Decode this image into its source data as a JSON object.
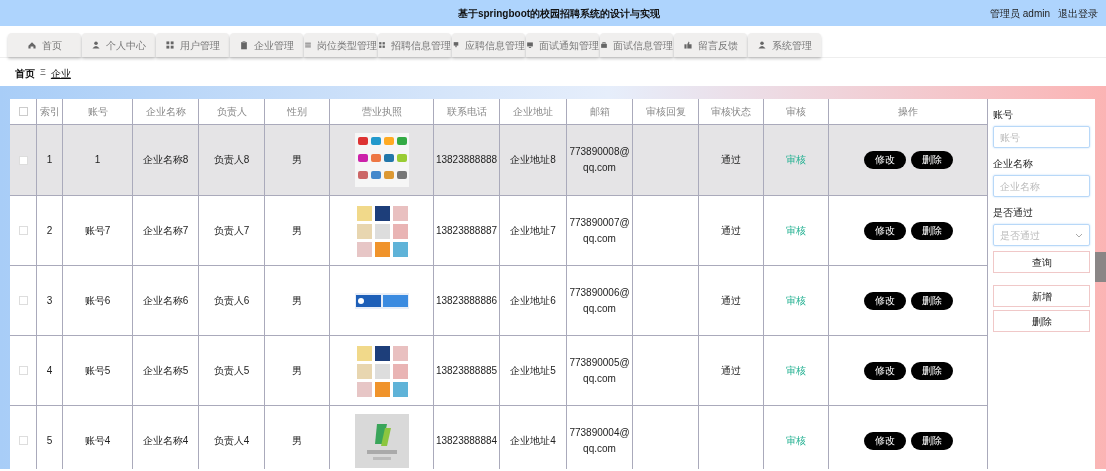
{
  "header": {
    "title": "基于springboot的校园招聘系统的设计与实现",
    "user": "管理员 admin",
    "logout": "退出登录"
  },
  "nav": [
    {
      "label": "首页",
      "selected": false
    },
    {
      "label": "个人中心",
      "selected": false
    },
    {
      "label": "用户管理",
      "selected": false
    },
    {
      "label": "企业管理",
      "selected": false
    },
    {
      "label": "岗位类型管理",
      "selected": false
    },
    {
      "label": "招聘信息管理",
      "selected": false
    },
    {
      "label": "应聘信息管理",
      "selected": false
    },
    {
      "label": "面试通知管理",
      "selected": false
    },
    {
      "label": "面试信息管理",
      "selected": false
    },
    {
      "label": "留言反馈",
      "selected": false
    },
    {
      "label": "系统管理",
      "selected": false
    }
  ],
  "breadcrumb": {
    "home": "首页",
    "separator": "Ξ",
    "current": "企业"
  },
  "table": {
    "select_all_checked": false,
    "columns": [
      "索引",
      "账号",
      "企业名称",
      "负责人",
      "性别",
      "营业执照",
      "联系电话",
      "企业地址",
      "邮箱",
      "审核回复",
      "审核状态",
      "审核",
      "操作"
    ],
    "rows": [
      {
        "selected": true,
        "checked": false,
        "cells": [
          "1",
          "1",
          "企业名称8",
          "负责人8",
          "男",
          "",
          "13823888888",
          "企业地址8",
          "773890008@qq.com",
          "",
          "通过"
        ],
        "review": "审核",
        "actions": [
          "修改",
          "删除"
        ]
      },
      {
        "selected": false,
        "checked": false,
        "cells": [
          "2",
          "账号7",
          "企业名称7",
          "负责人7",
          "男",
          "",
          "13823888887",
          "企业地址7",
          "773890007@qq.com",
          "",
          "通过"
        ],
        "review": "审核",
        "actions": [
          "修改",
          "删除"
        ]
      },
      {
        "selected": false,
        "checked": false,
        "cells": [
          "3",
          "账号6",
          "企业名称6",
          "负责人6",
          "男",
          "",
          "13823888886",
          "企业地址6",
          "773890006@qq.com",
          "",
          "通过"
        ],
        "review": "审核",
        "actions": [
          "修改",
          "删除"
        ]
      },
      {
        "selected": false,
        "checked": false,
        "cells": [
          "4",
          "账号5",
          "企业名称5",
          "负责人5",
          "男",
          "",
          "13823888885",
          "企业地址5",
          "773890005@qq.com",
          "",
          "通过"
        ],
        "review": "审核",
        "actions": [
          "修改",
          "删除"
        ]
      },
      {
        "selected": false,
        "checked": false,
        "cells": [
          "5",
          "账号4",
          "企业名称4",
          "负责人4",
          "男",
          "",
          "13823888884",
          "企业地址4",
          "773890004@qq.com",
          "",
          ""
        ],
        "review": "审核",
        "actions": [
          "修改",
          "删除"
        ]
      }
    ]
  },
  "search": {
    "fields": [
      {
        "label": "账号",
        "placeholder": "账号",
        "kind": "text"
      },
      {
        "label": "企业名称",
        "placeholder": "企业名称",
        "kind": "text"
      },
      {
        "label": "是否通过",
        "placeholder": "是否通过",
        "kind": "select"
      }
    ],
    "buttons": [
      "查询",
      "新增",
      "删除"
    ]
  }
}
